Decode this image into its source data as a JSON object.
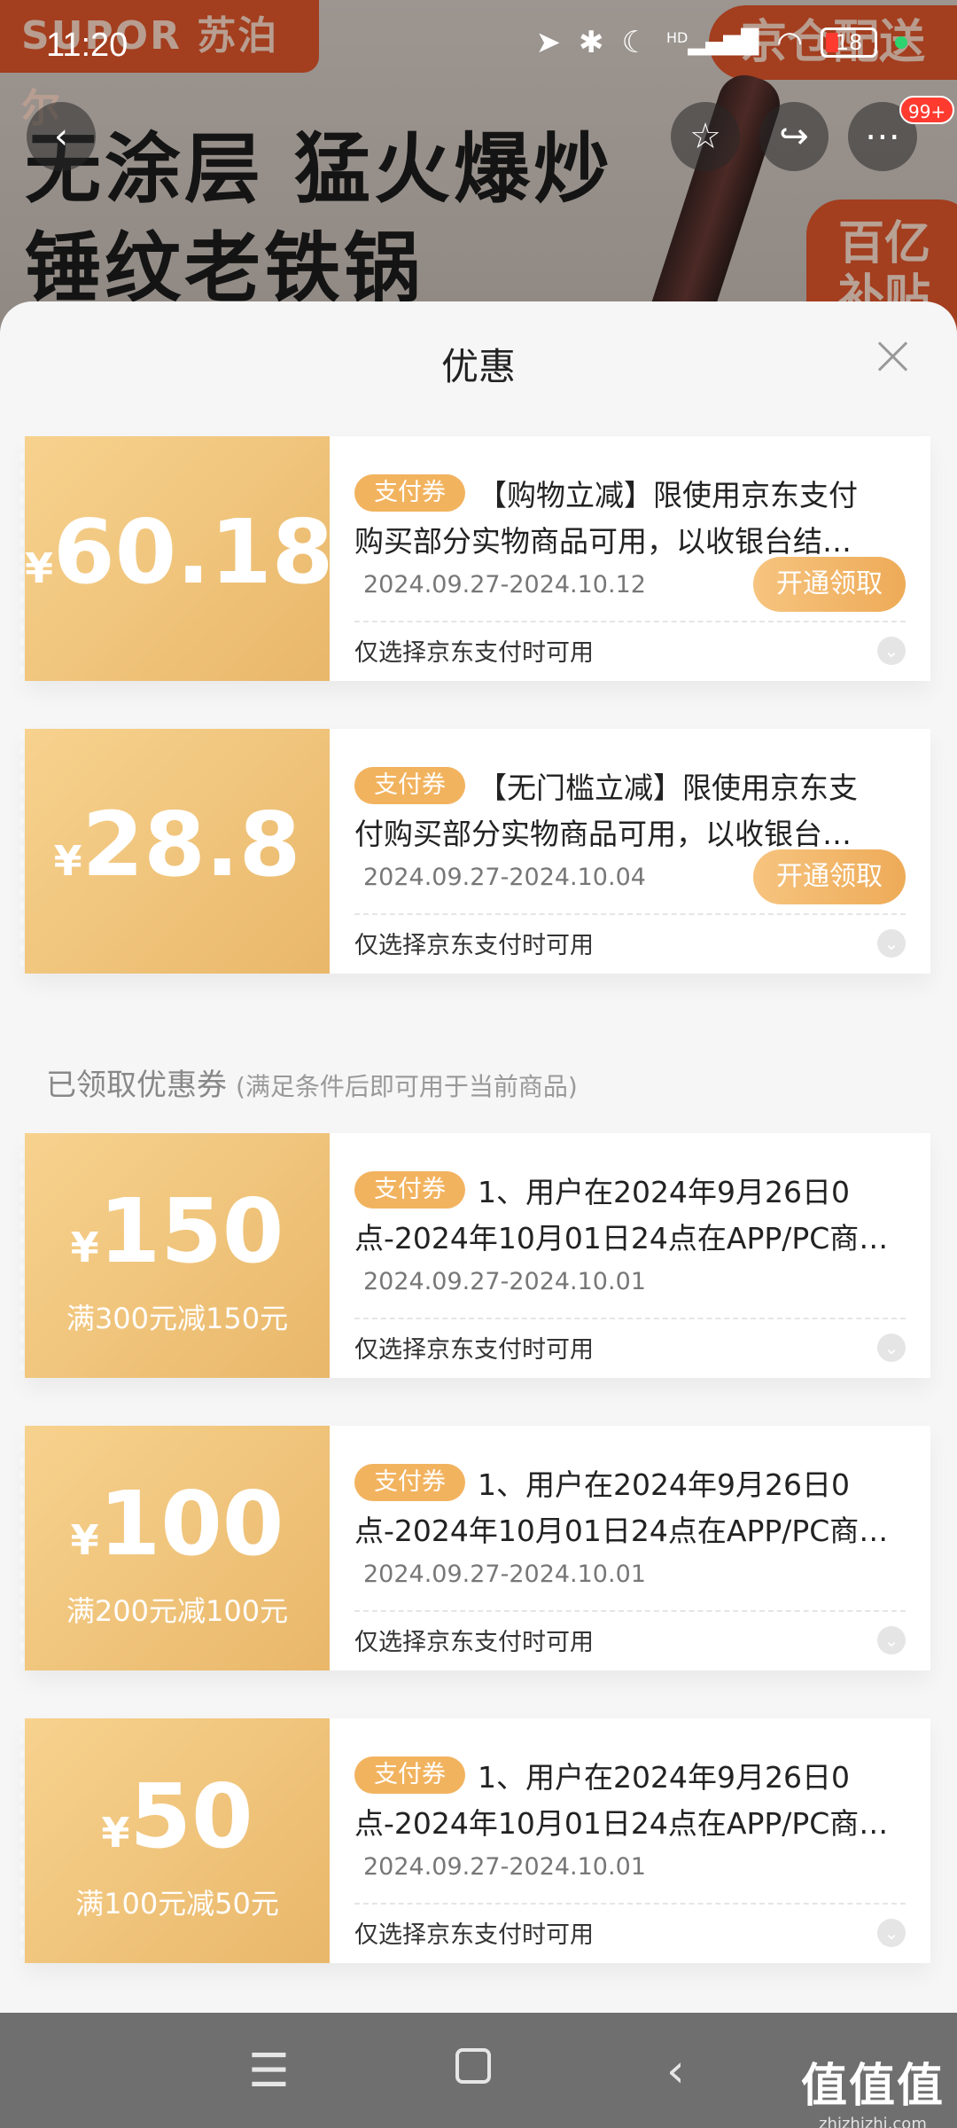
{
  "status_bar": {
    "time": "11:20",
    "battery": "18",
    "hd": "HD"
  },
  "background": {
    "brand": "SUPOR 苏泊尔",
    "promo_line1": "无涂层 猛火爆炒",
    "promo_line2": "锤纹老铁锅",
    "delivery": "京仓配送",
    "subsidy_line1": "百亿",
    "subsidy_line2": "补贴"
  },
  "nav": {
    "badge": "99+"
  },
  "sheet": {
    "title": "优惠",
    "available_coupons": [
      {
        "currency": "¥",
        "amount": "60.18",
        "condition": "",
        "tag": "支付券",
        "desc_line1": "【购物立减】限使用京东支付",
        "desc_line2": "购买部分实物商品可用，以收银台结…",
        "date": "2024.09.27-2024.10.12",
        "button": "开通领取",
        "hint": "仅选择京东支付时可用"
      },
      {
        "currency": "¥",
        "amount": "28.8",
        "condition": "",
        "tag": "支付券",
        "desc_line1": "【无门槛立减】限使用京东支",
        "desc_line2": "付购买部分实物商品可用，以收银台…",
        "date": "2024.09.27-2024.10.04",
        "button": "开通领取",
        "hint": "仅选择京东支付时可用"
      }
    ],
    "claimed_section": {
      "title": "已领取优惠券",
      "note": "(满足条件后即可用于当前商品)"
    },
    "claimed_coupons": [
      {
        "currency": "¥",
        "amount": "150",
        "condition": "满300元减150元",
        "tag": "支付券",
        "desc_line1": "1、用户在2024年9月26日0",
        "desc_line2": "点-2024年10月01日24点在APP/PC商…",
        "date": "2024.09.27-2024.10.01",
        "hint": "仅选择京东支付时可用"
      },
      {
        "currency": "¥",
        "amount": "100",
        "condition": "满200元减100元",
        "tag": "支付券",
        "desc_line1": "1、用户在2024年9月26日0",
        "desc_line2": "点-2024年10月01日24点在APP/PC商…",
        "date": "2024.09.27-2024.10.01",
        "hint": "仅选择京东支付时可用"
      },
      {
        "currency": "¥",
        "amount": "50",
        "condition": "满100元减50元",
        "tag": "支付券",
        "desc_line1": "1、用户在2024年9月26日0",
        "desc_line2": "点-2024年10月01日24点在APP/PC商…",
        "date": "2024.09.27-2024.10.01",
        "hint": "仅选择京东支付时可用"
      }
    ]
  },
  "watermark": {
    "main": "值值值",
    "sub": "zhizhizhi.com"
  },
  "colors": {
    "coupon_gold": "#e9b76a",
    "tag_gold": "#f2b35f",
    "brand_orange": "#e2572b"
  }
}
